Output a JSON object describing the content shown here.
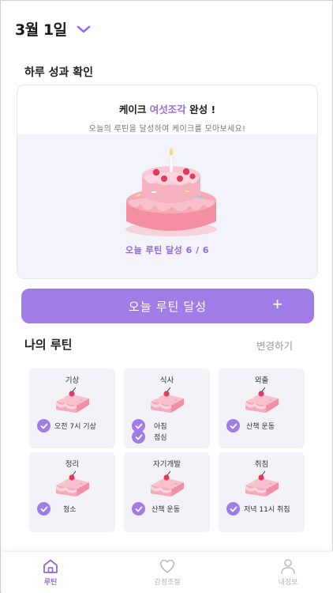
{
  "header": {
    "date": "3월 1일"
  },
  "summary": {
    "title": "하루 성과 확인",
    "headline_prefix": "케이크",
    "headline_accent": "여섯조각",
    "headline_suffix": "완성 !",
    "subline": "오늘의 루틴을 달성하여 케이크를 모아보세요!",
    "count": "오늘 루틴 달성 6 / 6"
  },
  "achieve_button": {
    "label": "오늘 루틴 달성",
    "icon": "plus-icon"
  },
  "routines": {
    "title": "나의 루틴",
    "edit": "변경하기",
    "tiles": [
      {
        "title": "기상",
        "tasks": [
          "오전 7시 기상"
        ]
      },
      {
        "title": "식사",
        "tasks": [
          "아침",
          "점심"
        ]
      },
      {
        "title": "외출",
        "tasks": [
          "산책 운동"
        ]
      },
      {
        "title": "정리",
        "tasks": [
          "청소"
        ]
      },
      {
        "title": "자기개발",
        "tasks": [
          "산책 운동"
        ]
      },
      {
        "title": "취침",
        "tasks": [
          "저녁 11시 취침"
        ]
      }
    ]
  },
  "nav": {
    "items": [
      {
        "label": "루틴",
        "icon": "home-icon",
        "active": true
      },
      {
        "label": "감정조절",
        "icon": "heart-icon",
        "active": false
      },
      {
        "label": "내정보",
        "icon": "person-icon",
        "active": false
      }
    ]
  },
  "colors": {
    "accent": "#a07ce6",
    "accent_text": "#9467e0",
    "panel": "#f3f3fb",
    "tile": "#f2f2f8",
    "cake_pink": "#f28ba0"
  }
}
